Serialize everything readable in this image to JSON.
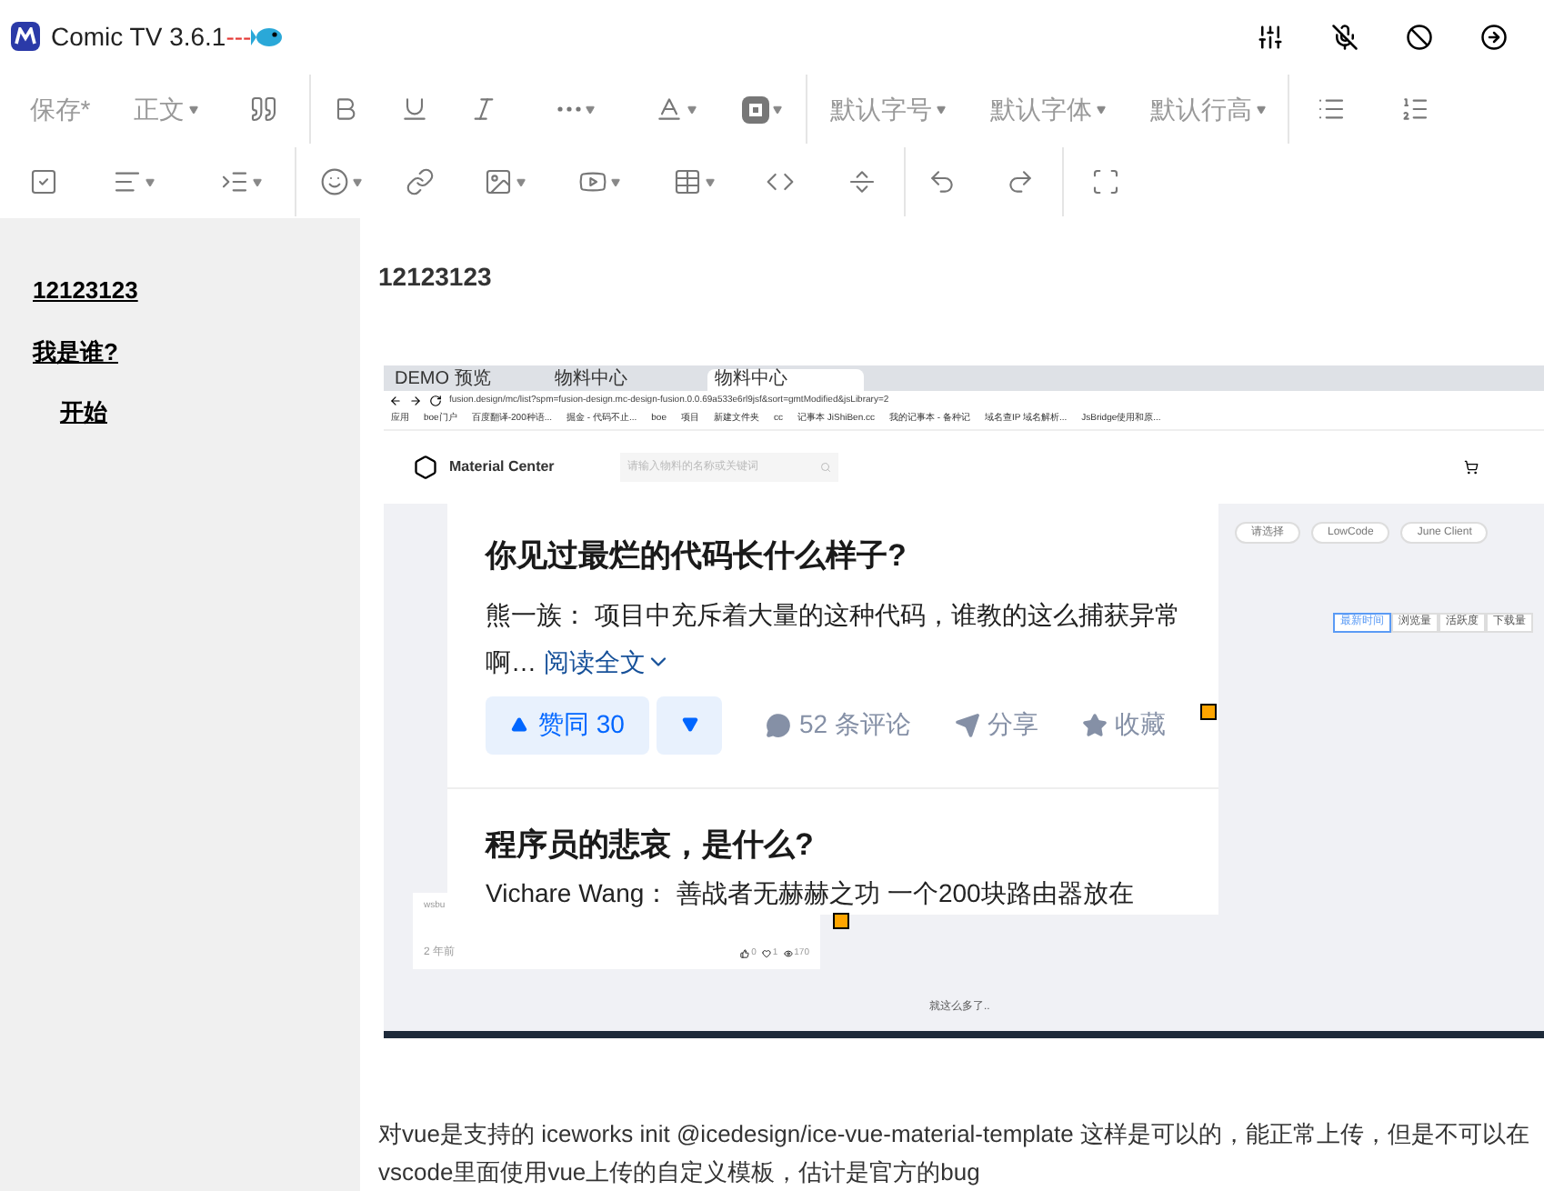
{
  "window": {
    "title": "Comic TV 3.6.1",
    "title_suffix": "---"
  },
  "toolbar": {
    "rows": [
      [
        [
          {
            "label": "保存*",
            "dropdown": false
          },
          {
            "label": "正文",
            "dropdown": true
          },
          {
            "dropdown": false
          }
        ],
        [
          {
            "dropdown": false
          },
          {
            "dropdown": false
          },
          {
            "dropdown": false
          },
          {
            "dropdown": true
          },
          {
            "dropdown": true
          },
          {
            "dropdown": true
          }
        ],
        [
          {
            "label": "默认字号",
            "dropdown": true
          },
          {
            "label": "默认字体",
            "dropdown": true
          },
          {
            "label": "默认行高",
            "dropdown": true
          }
        ],
        [
          {
            "dropdown": false
          },
          {
            "dropdown": false
          }
        ]
      ],
      [
        [
          {
            "dropdown": false
          },
          {
            "dropdown": true
          },
          {
            "dropdown": true
          }
        ],
        [
          {
            "dropdown": true
          },
          {
            "dropdown": false
          },
          {
            "dropdown": true
          },
          {
            "dropdown": true
          },
          {
            "dropdown": true
          },
          {
            "dropdown": false
          },
          {
            "dropdown": false
          }
        ],
        [
          {
            "dropdown": false
          },
          {
            "dropdown": false
          }
        ],
        [
          {
            "dropdown": false
          }
        ]
      ]
    ]
  },
  "outline": [
    {
      "label": "12123123"
    },
    {
      "label": "我是谁?",
      "children": [
        {
          "label": "开始"
        }
      ]
    }
  ],
  "document": {
    "heading": "12123123",
    "screenshot": {
      "tabs": [
        {
          "label": "DEMO 预览",
          "selected": false
        },
        {
          "label": "物料中心",
          "selected": false
        },
        {
          "label": "物料中心",
          "selected": true
        }
      ],
      "url": "fusion.design/mc/list?spm=fusion-design.mc-design-fusion.0.0.69a533e6rl9jsf&sort=gmtModified&jsLibrary=2",
      "bookmarks": [
        "应用",
        "boe门户",
        "百度翻译-200种语...",
        "掘金 - 代码不止...",
        "boe",
        "项目",
        "新建文件夹",
        "cc",
        "记事本 JiShiBen.cc",
        "我的记事本 - 备种记",
        "域名查IP 域名解析...",
        "JsBridge使用和原..."
      ],
      "site_name": "Material Center",
      "search_placeholder": "请输入物料的名称或关键词",
      "filters": [
        "请选择",
        "LowCode",
        "June Client"
      ],
      "sort_tabs": [
        {
          "label": "最新时间",
          "selected": true
        },
        {
          "label": "浏览量",
          "selected": false
        },
        {
          "label": "活跃度",
          "selected": false
        },
        {
          "label": "下载量",
          "selected": false
        }
      ],
      "card": {
        "author": "wsbu",
        "age": "2 年前",
        "likes": "0",
        "hearts": "1",
        "views": "170"
      },
      "footer": "就这么多了..",
      "answers": [
        {
          "title": "你见过最烂的代码长什么样子?",
          "author": "熊一族：",
          "excerpt": "项目中充斥着大量的这种代码，谁教的这么捕获异常啊…",
          "read_more": "阅读全文",
          "upvote": "赞同 30",
          "comments": "52 条评论",
          "share": "分享",
          "collect": "收藏"
        },
        {
          "title": "程序员的悲哀，是什么?",
          "author": "Vichare Wang：",
          "excerpt": "善战者无赫赫之功 一个200块路由器放在"
        }
      ]
    },
    "paragraph": "对vue是支持的 iceworks init @icedesign/ice-vue-material-template 这样是可以的，能正常上传，但是不可以在vscode里面使用vue上传的自定义模板，估计是官方的bug"
  }
}
